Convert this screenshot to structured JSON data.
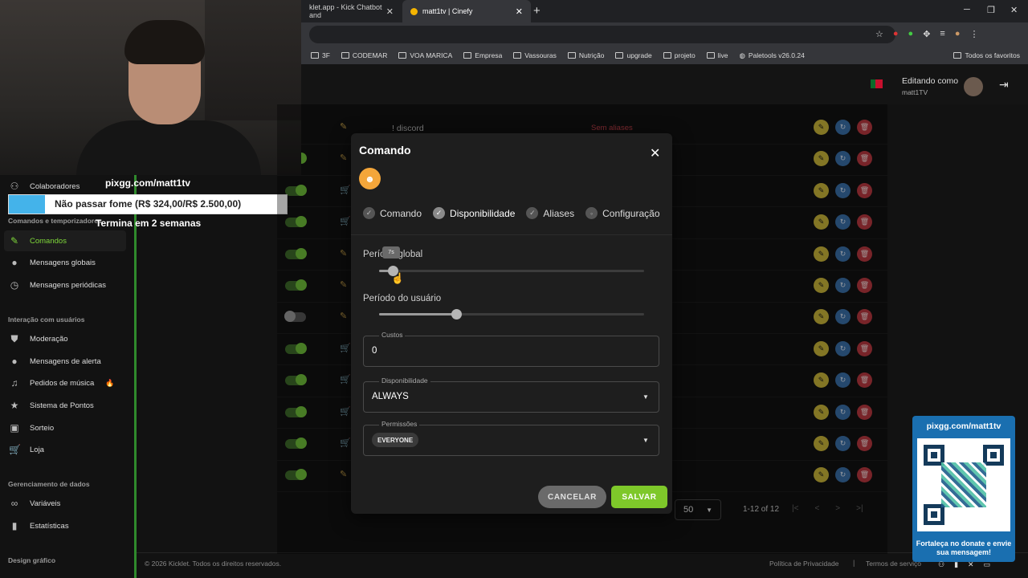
{
  "browser": {
    "tabs": [
      {
        "label": "klet.app - Kick Chatbot and"
      },
      {
        "label": "matt1tv | Cinefy"
      }
    ],
    "bookmarks": [
      "3F",
      "CODEMAR",
      "VOA MARICA",
      "Empresa",
      "Vassouras",
      "Nutrição",
      "upgrade",
      "projeto",
      "live",
      "Paletools v26.0.24"
    ],
    "all_bookmarks": "Todos os favoritos"
  },
  "header": {
    "editing_label": "Editando como",
    "editing_user": "matt1TV"
  },
  "sidebar": {
    "items_top": [
      {
        "label": "Colaboradores"
      }
    ],
    "section_commands": "Comandos e temporizadores",
    "commands_items": [
      {
        "label": "Comandos"
      },
      {
        "label": "Mensagens globais"
      },
      {
        "label": "Mensagens periódicas"
      }
    ],
    "section_interaction": "Interação com usuários",
    "interaction_items": [
      {
        "label": "Moderação"
      },
      {
        "label": "Mensagens de alerta"
      },
      {
        "label": "Pedidos de música"
      },
      {
        "label": "Sistema de Pontos"
      },
      {
        "label": "Sorteio"
      },
      {
        "label": "Loja"
      }
    ],
    "section_data": "Gerenciamento de dados",
    "data_items": [
      {
        "label": "Variáveis"
      },
      {
        "label": "Estatísticas"
      }
    ],
    "section_design": "Design gráfico"
  },
  "overlay": {
    "pix_url": "pixgg.com/matt1tv",
    "goal_text": "Não passar fome (R$ 324,00/R$ 2.500,00)",
    "goal_progress": 0.1296,
    "goal_time": "Termina em 2 semanas",
    "qr_title": "pixgg.com/matt1tv",
    "qr_bottom": "Fortaleça no donate e envie sua mensagem!"
  },
  "table": {
    "first_row_name": "! discord",
    "first_row_aliases": "Sem aliases",
    "rows": [
      {
        "enabled": true,
        "icon": "pencil-icon"
      },
      {
        "enabled": true,
        "icon": "pencil-icon"
      },
      {
        "enabled": true,
        "icon": "cart-icon"
      },
      {
        "enabled": true,
        "icon": "cart-icon"
      },
      {
        "enabled": true,
        "icon": "pencil-icon"
      },
      {
        "enabled": true,
        "icon": "pencil-icon"
      },
      {
        "enabled": false,
        "icon": "pencil-icon"
      },
      {
        "enabled": true,
        "icon": "cart-icon"
      },
      {
        "enabled": true,
        "icon": "cart-icon"
      },
      {
        "enabled": true,
        "icon": "cart-icon"
      },
      {
        "enabled": true,
        "icon": "cart-icon"
      },
      {
        "enabled": true,
        "icon": "pencil-icon"
      }
    ]
  },
  "pagination": {
    "page_size": "50",
    "range": "1-12 of 12"
  },
  "footer": {
    "copyright": "© 2026 Kicklet. Todos os direitos reservados.",
    "privacy": "Política de Privacidade",
    "separator": "|",
    "terms": "Termos de serviço"
  },
  "modal": {
    "title": "Comando",
    "steps": [
      {
        "label": "Comando",
        "active": false
      },
      {
        "label": "Disponibilidade",
        "active": true
      },
      {
        "label": "Aliases",
        "active": false
      },
      {
        "label": "Configuração",
        "active": false
      }
    ],
    "global_period_label": "Período global",
    "global_period_value": 0.05,
    "global_tooltip": "7s",
    "user_period_label": "Período do usuário",
    "user_period_value": 0.29,
    "costs_label": "Custos",
    "costs_value": "0",
    "availability_label": "Disponibilidade",
    "availability_value": "ALWAYS",
    "permissions_label": "Permissões",
    "permissions_value": "EVERYONE",
    "cancel_label": "CANCELAR",
    "save_label": "SALVAR"
  },
  "colors": {
    "accent": "#7ec82a",
    "edit": "#c9b53a",
    "reset": "#3a6fa8",
    "delete": "#b8383f"
  }
}
